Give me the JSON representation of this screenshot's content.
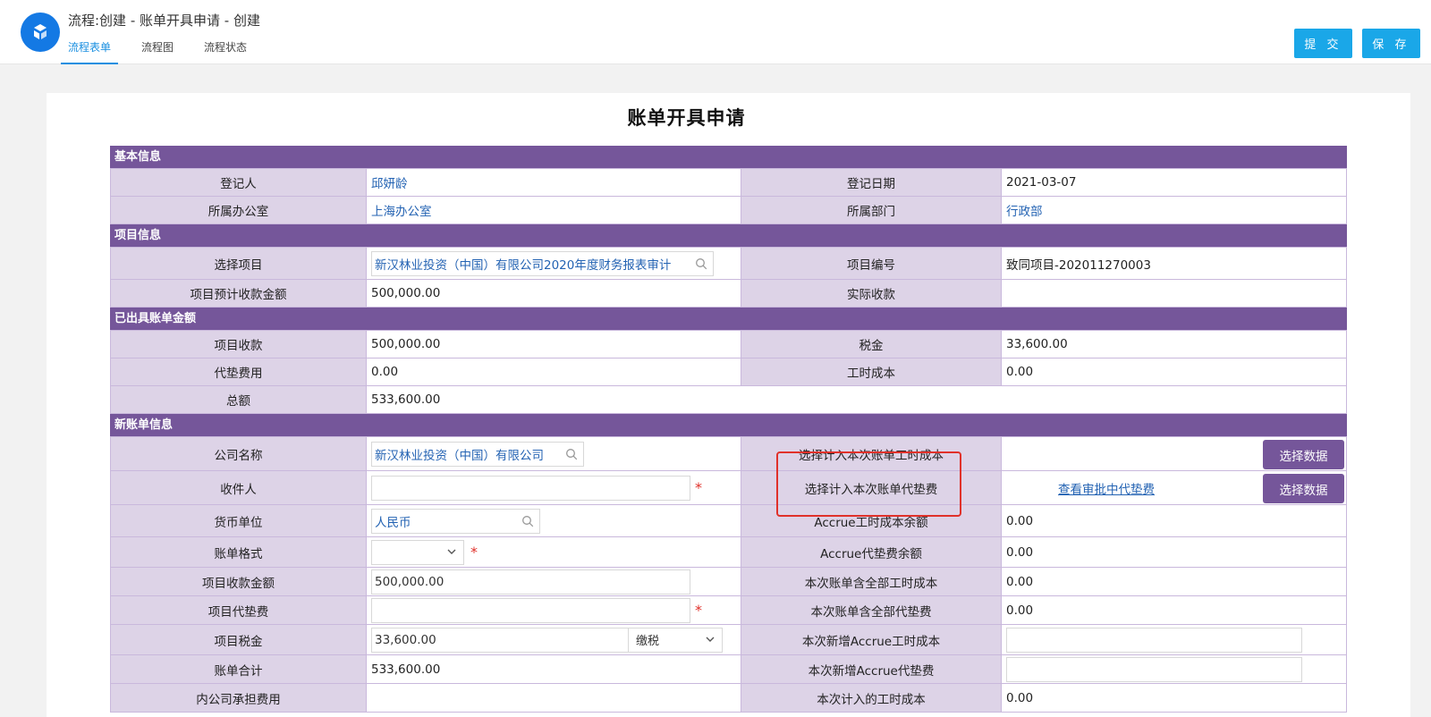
{
  "header": {
    "title": "流程:创建 - 账单开具申请 - 创建",
    "tabs": [
      {
        "label": "流程表单",
        "active": true
      },
      {
        "label": "流程图",
        "active": false
      },
      {
        "label": "流程状态",
        "active": false
      }
    ],
    "submit_label": "提 交",
    "save_label": "保 存"
  },
  "form": {
    "title": "账单开具申请",
    "basic": {
      "section": "基本信息",
      "registrant_label": "登记人",
      "registrant": "邱妍龄",
      "reg_date_label": "登记日期",
      "reg_date": "2021-03-07",
      "office_label": "所属办公室",
      "office": "上海办公室",
      "dept_label": "所属部门",
      "dept": "行政部"
    },
    "project": {
      "section": "项目信息",
      "select_label": "选择项目",
      "select_value": "新汉林业投资（中国）有限公司2020年度财务报表审计",
      "code_label": "项目编号",
      "code": "致同项目-202011270003",
      "expected_label": "项目预计收款金额",
      "expected": "500,000.00",
      "actual_label": "实际收款",
      "actual": ""
    },
    "issued": {
      "section": "已出具账单金额",
      "receipt_label": "项目收款",
      "receipt": "500,000.00",
      "tax_label": "税金",
      "tax": "33,600.00",
      "advance_label": "代垫费用",
      "advance": "0.00",
      "labor_label": "工时成本",
      "labor": "0.00",
      "total_label": "总额",
      "total": "533,600.00"
    },
    "newbill": {
      "section": "新账单信息",
      "company_label": "公司名称",
      "company": "新汉林业投资（中国）有限公司",
      "include_labor_label": "选择计入本次账单工时成本",
      "select_data_label": "选择数据",
      "recipient_label": "收件人",
      "recipient": "",
      "include_advance_label": "选择计入本次账单代垫费",
      "view_advance_link": "查看审批中代垫费",
      "currency_label": "货币单位",
      "currency": "人民币",
      "accrue_labor_label": "Accrue工时成本余额",
      "accrue_labor": "0.00",
      "format_label": "账单格式",
      "format": "",
      "accrue_advance_label": "Accrue代垫费余额",
      "accrue_advance": "0.00",
      "proj_receipt_label": "项目收款金额",
      "proj_receipt": "500,000.00",
      "all_labor_label": "本次账单含全部工时成本",
      "all_labor": "0.00",
      "proj_advance_label": "项目代垫费",
      "proj_advance": "",
      "all_advance_label": "本次账单含全部代垫费",
      "all_advance": "0.00",
      "proj_tax_label": "项目税金",
      "proj_tax": "33,600.00",
      "tax_mode": "缴税",
      "new_accrue_labor_label": "本次新增Accrue工时成本",
      "new_accrue_labor": "",
      "bill_total_label": "账单合计",
      "bill_total": "533,600.00",
      "new_accrue_advance_label": "本次新增Accrue代垫费",
      "new_accrue_advance": "",
      "inner_label": "内公司承担费用",
      "this_labor_label": "本次计入的工时成本",
      "this_labor": "0.00"
    }
  },
  "colors": {
    "primary": "#1aa7e8",
    "section": "#75569a",
    "label_bg": "#ddd3e7",
    "highlight": "#e0312a"
  },
  "icons": [
    "flow-logo-icon",
    "search-icon",
    "chevron-down-icon",
    "required-star-icon"
  ]
}
